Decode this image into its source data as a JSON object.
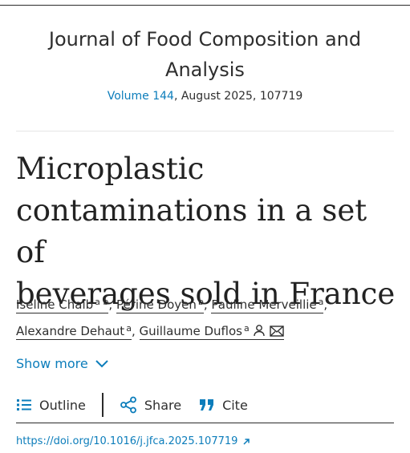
{
  "journal": {
    "name_line1": "Journal of Food Composition and",
    "name_line2": "Analysis",
    "volume_link": "Volume 144",
    "issue_info": ", August 2025, 107719"
  },
  "article": {
    "title_line1": "Microplastic",
    "title_line2": "contaminations in a set of",
    "title_line3": "beverages sold in France"
  },
  "authors": [
    {
      "name": "Iseline Chaïb",
      "affil": "a b"
    },
    {
      "name": "Périne Doyen",
      "affil": "b"
    },
    {
      "name": "Pauline Merveillie",
      "affil": "a"
    },
    {
      "name": "Alexandre Dehaut",
      "affil": "a"
    },
    {
      "name": "Guillaume Duflos",
      "affil": "a"
    }
  ],
  "show_more": "Show more",
  "actions": {
    "outline": "Outline",
    "share": "Share",
    "cite": "Cite"
  },
  "doi": "https://doi.org/10.1016/j.jfca.2025.107719",
  "colors": {
    "link": "#0c7dbb",
    "text": "#2e2e2e",
    "background": "#ffffff"
  },
  "icons": [
    "person-icon",
    "mail-icon",
    "chevron-down-icon",
    "list-icon",
    "share-icon",
    "quote-icon",
    "external-link-icon"
  ]
}
